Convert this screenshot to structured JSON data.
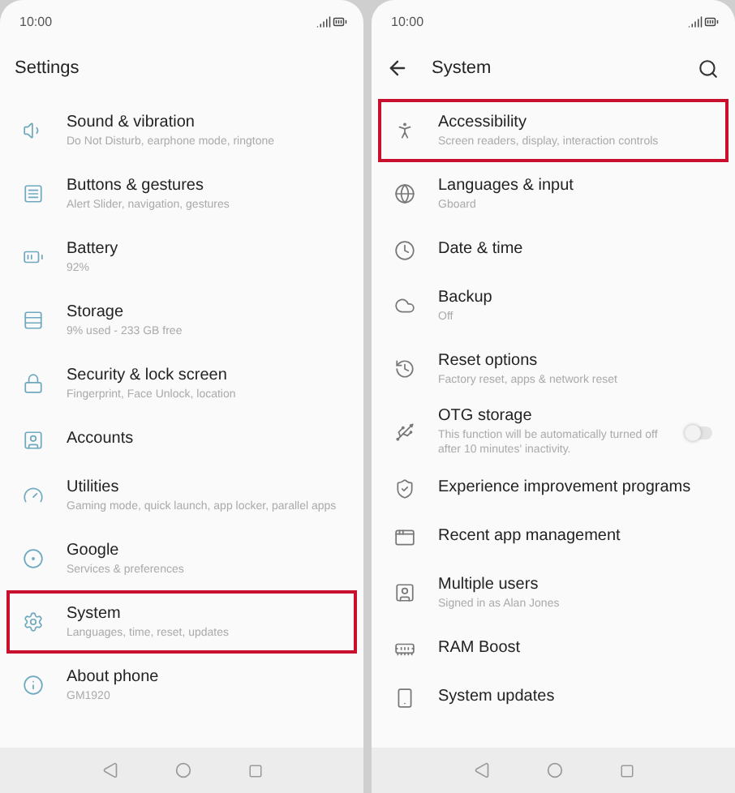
{
  "screens": [
    {
      "status_bar": {
        "time": "10:00"
      },
      "header": {
        "title": "Settings",
        "back": false,
        "search": false
      },
      "items": [
        {
          "title": "Sound & vibration",
          "subtitle": "Do Not Disturb, earphone mode, ringtone",
          "highlighted": false
        },
        {
          "title": "Buttons & gestures",
          "subtitle": "Alert Slider, navigation, gestures",
          "highlighted": false
        },
        {
          "title": "Battery",
          "subtitle": "92%",
          "highlighted": false
        },
        {
          "title": "Storage",
          "subtitle": "9% used - 233 GB free",
          "highlighted": false
        },
        {
          "title": "Security & lock screen",
          "subtitle": "Fingerprint, Face Unlock, location",
          "highlighted": false
        },
        {
          "title": "Accounts",
          "highlighted": false
        },
        {
          "title": "Utilities",
          "subtitle": "Gaming mode, quick launch, app locker, parallel apps",
          "highlighted": false
        },
        {
          "title": "Google",
          "subtitle": "Services & preferences",
          "highlighted": false
        },
        {
          "title": "System",
          "subtitle": "Languages, time, reset, updates",
          "highlighted": true
        },
        {
          "title": "About phone",
          "subtitle": "GM1920",
          "highlighted": false
        }
      ]
    },
    {
      "status_bar": {
        "time": "10:00"
      },
      "header": {
        "title": "System",
        "back": true,
        "search": true
      },
      "items": [
        {
          "title": "Accessibility",
          "subtitle": "Screen readers, display, interaction controls",
          "highlighted": true
        },
        {
          "title": "Languages & input",
          "subtitle": "Gboard",
          "highlighted": false
        },
        {
          "title": "Date & time",
          "highlighted": false
        },
        {
          "title": "Backup",
          "subtitle": "Off",
          "highlighted": false
        },
        {
          "title": "Reset options",
          "subtitle": "Factory reset, apps & network reset",
          "highlighted": false
        },
        {
          "title": "OTG storage",
          "subtitle": "This function will be automatically turned off after 10 minutes' inactivity.",
          "highlighted": false,
          "switch": {
            "on": false
          }
        },
        {
          "title": "Experience improvement programs",
          "highlighted": false
        },
        {
          "title": "Recent app management",
          "highlighted": false
        },
        {
          "title": "Multiple users",
          "subtitle": "Signed in as Alan Jones",
          "highlighted": false
        },
        {
          "title": "RAM Boost",
          "highlighted": false
        },
        {
          "title": "System updates",
          "highlighted": false
        }
      ]
    }
  ]
}
